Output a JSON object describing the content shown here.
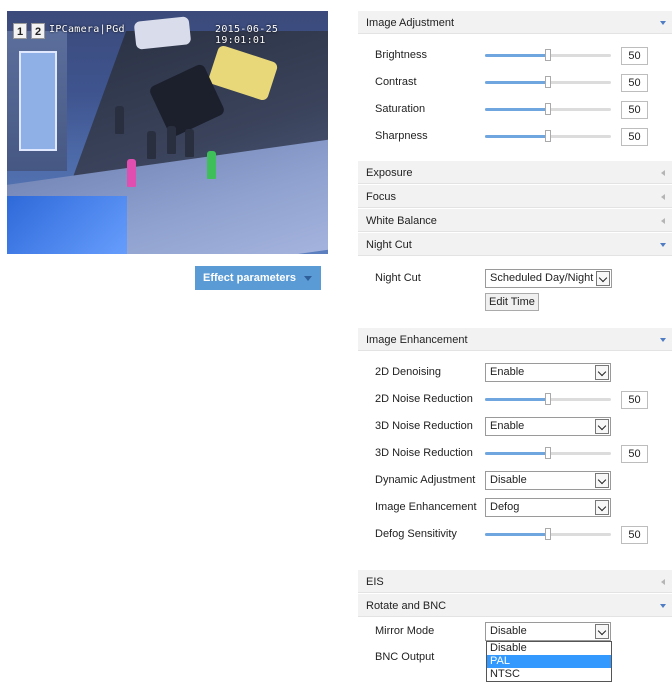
{
  "video": {
    "channel_1": "1",
    "channel_2": "2",
    "camera_name": "IPCamera|PGd",
    "timestamp": "2015-06-25 19:01:01"
  },
  "effect_button": "Effect parameters",
  "image_adjustment": {
    "title": "Image Adjustment",
    "sliders": [
      {
        "label": "Brightness",
        "value": "50",
        "level": 0.5
      },
      {
        "label": "Contrast",
        "value": "50",
        "level": 0.5
      },
      {
        "label": "Saturation",
        "value": "50",
        "level": 0.5
      },
      {
        "label": "Sharpness",
        "value": "50",
        "level": 0.5
      }
    ]
  },
  "exposure": {
    "title": "Exposure"
  },
  "focus": {
    "title": "Focus"
  },
  "white_balance": {
    "title": "White Balance"
  },
  "night_cut": {
    "title": "Night Cut",
    "label": "Night Cut",
    "value": "Scheduled Day/Night",
    "edit_time": "Edit Time"
  },
  "image_enhancement": {
    "title": "Image Enhancement",
    "denoising_2d": {
      "label": "2D Denoising",
      "value": "Enable"
    },
    "noise_reduction_2d": {
      "label": "2D Noise Reduction",
      "value": "50",
      "level": 0.5
    },
    "noise_reduction_3d_mode": {
      "label": "3D Noise Reduction",
      "value": "Enable"
    },
    "noise_reduction_3d": {
      "label": "3D Noise Reduction",
      "value": "50",
      "level": 0.5
    },
    "dynamic_adjustment": {
      "label": "Dynamic Adjustment",
      "value": "Disable"
    },
    "enhancement": {
      "label": "Image Enhancement",
      "value": "Defog"
    },
    "defog_sensitivity": {
      "label": "Defog Sensitivity",
      "value": "50",
      "level": 0.5
    }
  },
  "eis": {
    "title": "EIS"
  },
  "rotate_bnc": {
    "title": "Rotate and BNC",
    "mirror_mode": {
      "label": "Mirror Mode",
      "value": "Disable"
    },
    "bnc_output": {
      "label": "BNC Output"
    },
    "dropdown_options": [
      "Disable",
      "PAL",
      "NTSC"
    ],
    "dropdown_selected": "PAL"
  },
  "colors": {
    "accent": "#5b9bd5",
    "slider_fill": "#6fa6e0",
    "header_bg": "#f2f2f2",
    "selected_option": "#3399ff"
  }
}
